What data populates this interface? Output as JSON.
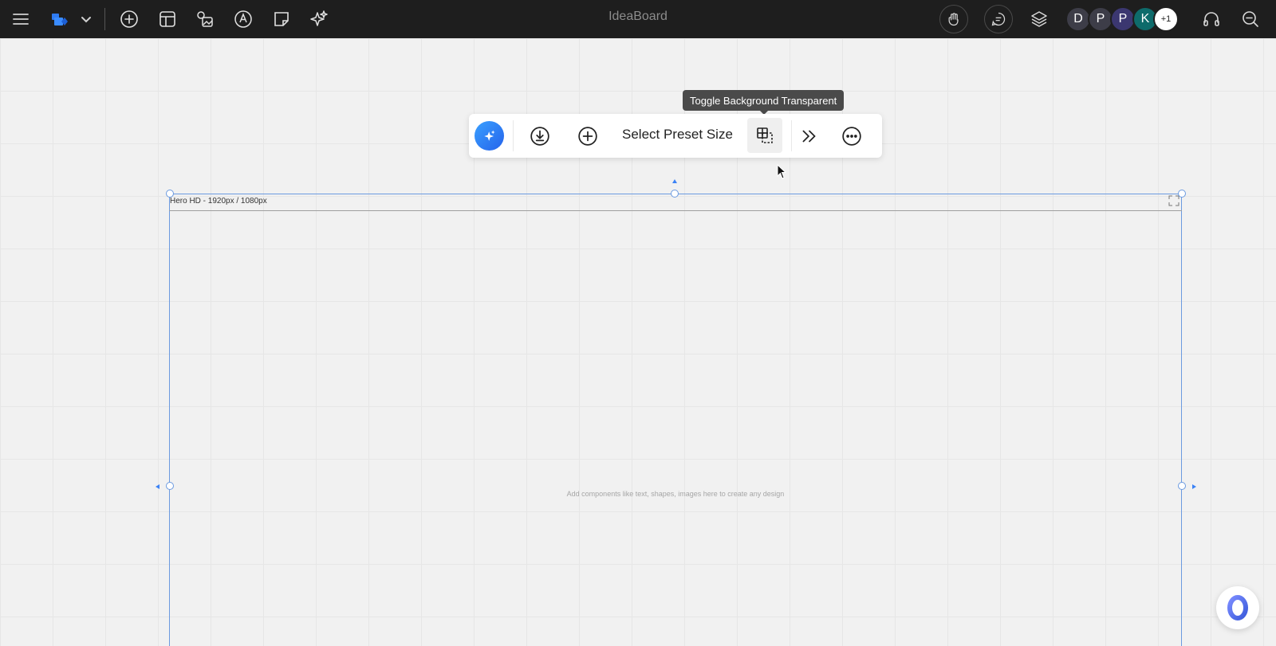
{
  "app": {
    "title": "IdeaBoard"
  },
  "topbar": {
    "left_icons": [
      "menu-icon",
      "logo-icon",
      "chevron-down-icon",
      "add-circle-icon",
      "template-icon",
      "media-icon",
      "pen-icon",
      "sticky-note-icon",
      "ai-sparkle-icon"
    ],
    "right_icons": [
      "hand-icon",
      "comment-icon",
      "layers-icon",
      "headset-icon",
      "zoom-out-icon"
    ],
    "avatars": [
      {
        "initial": "D",
        "color": "#3d3d48"
      },
      {
        "initial": "P",
        "color": "#3d3d48"
      },
      {
        "initial": "P",
        "color": "#3b3770"
      },
      {
        "initial": "K",
        "color": "#0e6b6b"
      }
    ],
    "more_avatars": "+1"
  },
  "floating_toolbar": {
    "preset_label": "Select Preset Size",
    "tooltip": "Toggle Background Transparent",
    "icons": [
      "ai-sparkle-icon",
      "download-icon",
      "add-icon",
      "transparent-bg-icon",
      "double-chevron-right-icon",
      "more-icon"
    ]
  },
  "frame": {
    "title": "Hero HD - 1920px / 1080px",
    "placeholder": "Add components like text, shapes, images here to create any design"
  },
  "colors": {
    "topbar_bg": "#1e1e1e",
    "accent": "#2563eb",
    "selection": "#6b9ae0"
  }
}
